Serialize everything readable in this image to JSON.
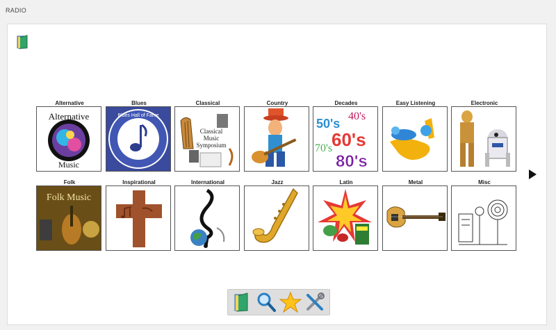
{
  "page": {
    "title": "RADIO"
  },
  "genres": [
    {
      "label": "Alternative"
    },
    {
      "label": "Blues"
    },
    {
      "label": "Classical"
    },
    {
      "label": "Country"
    },
    {
      "label": "Decades"
    },
    {
      "label": "Easy Listening"
    },
    {
      "label": "Electronic"
    },
    {
      "label": "Folk"
    },
    {
      "label": "Inspirational"
    },
    {
      "label": "International"
    },
    {
      "label": "Jazz"
    },
    {
      "label": "Latin"
    },
    {
      "label": "Metal"
    },
    {
      "label": "Misc"
    }
  ],
  "thumb_text": {
    "alternative_top": "Alternative",
    "alternative_bottom": "Music",
    "blues_ring": "Blues Hall of Fame",
    "classical_1": "Classical",
    "classical_2": "Music",
    "classical_3": "Symposium",
    "decades_50": "50's",
    "decades_40": "40's",
    "decades_60": "60's",
    "decades_70": "70's",
    "decades_80": "80's",
    "folk_title": "Folk Music"
  },
  "toolbar": {
    "icons": [
      "folder-icon",
      "search-icon",
      "star-icon",
      "tools-icon"
    ]
  },
  "navigation": {
    "next_icon": "play-arrow-icon"
  }
}
